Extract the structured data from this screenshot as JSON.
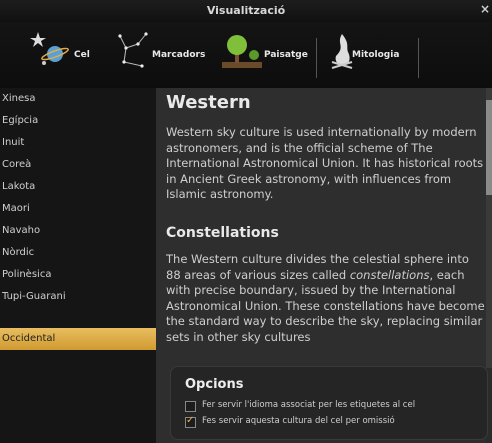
{
  "window": {
    "title": "Visualització",
    "close_glyph": "×"
  },
  "tabs": [
    {
      "label": "Cel",
      "icon": "sky-icon"
    },
    {
      "label": "Marcadors",
      "icon": "markers-icon"
    },
    {
      "label": "Paisatge",
      "icon": "landscape-icon"
    },
    {
      "label": "Mitologia",
      "icon": "mythology-icon"
    }
  ],
  "sidebar": {
    "items": [
      "Xinesa",
      "Egípcia",
      "Inuit",
      "Coreà",
      "Lakota",
      "Maori",
      "Navaho",
      "Nòrdic",
      "Polinèsica",
      "Tupi-Guarani",
      "Occidental"
    ],
    "selected": "Occidental"
  },
  "content": {
    "title": "Western",
    "intro": "Western sky culture is used internationally by modern astronomers, and is the official scheme of The International Astronomical Union. It has historical roots in Ancient Greek astronomy, with influences from Islamic astronomy.",
    "section_title": "Constellations",
    "section_text_before": "The Western culture divides the celestial sphere into 88 areas of various sizes called ",
    "section_text_em": "constellations",
    "section_text_after": ", each with precise boundary, issued by the International Astronomical Union. These constellations have become the standard way to describe the sky, replacing similar sets in other sky cultures"
  },
  "options": {
    "title": "Opcions",
    "items": [
      {
        "label": "Fer servir l'idioma associat per les etiquetes al cel",
        "checked": false
      },
      {
        "label": "Fes servir aquesta cultura del cel per omissió",
        "checked": true
      }
    ]
  },
  "colors": {
    "accent": "#e0ad45",
    "background": "#2e2e2e"
  }
}
